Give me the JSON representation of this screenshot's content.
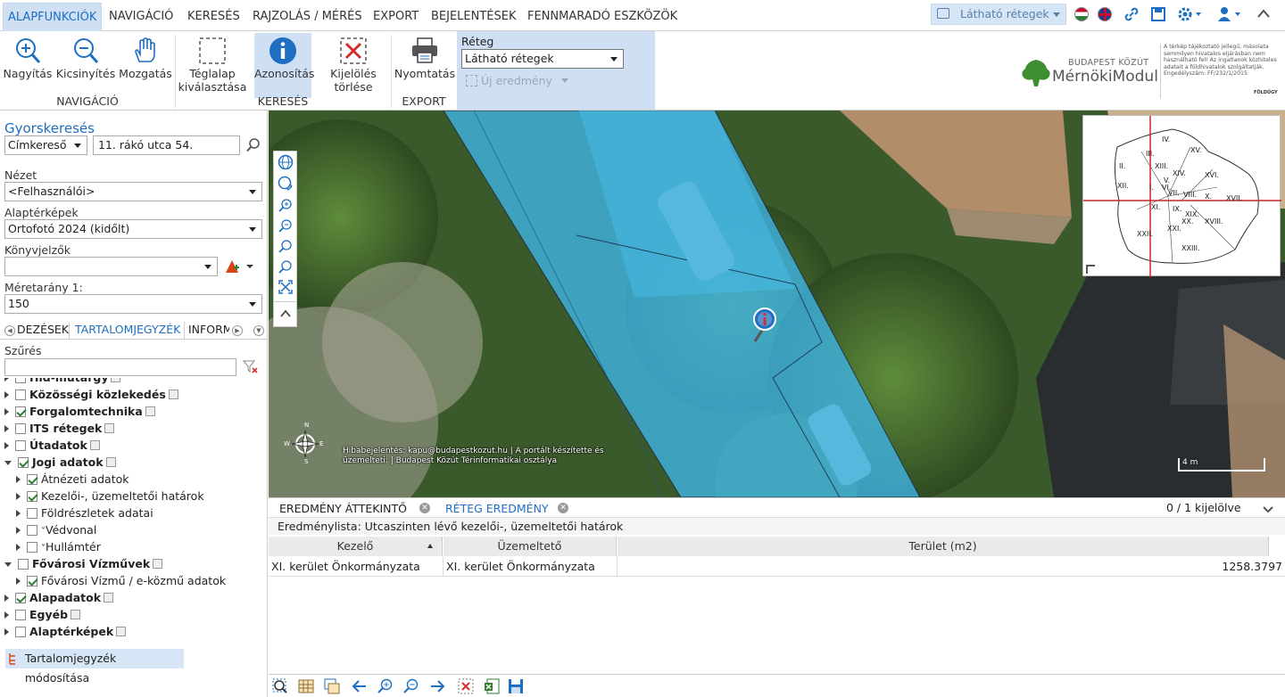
{
  "tabs": [
    "ALAPFUNKCIÓK",
    "NAVIGÁCIÓ",
    "KERESÉS",
    "RAJZOLÁS / MÉRÉS",
    "EXPORT",
    "BEJELENTÉSEK",
    "FENNMARADÓ ESZKÖZÖK"
  ],
  "topright": {
    "visible_layers": "Látható rétegek"
  },
  "ribbon": {
    "zoom_in": "Nagyítás",
    "zoom_out": "Kicsinyítés",
    "pan": "Mozgatás",
    "rect_select": "Téglalap kiválasztása",
    "identify": "Azonosítás",
    "clear_selection": "Kijelölés törlése",
    "print": "Nyomtatás",
    "group_nav": "NAVIGÁCIÓ",
    "group_search": "KERESÉS",
    "group_export": "EXPORT",
    "layer_label": "Réteg",
    "layer_value": "Látható rétegek",
    "new_result": "Új eredmény"
  },
  "logo": {
    "line1": "BUDAPEST KÖZÚT",
    "line2": "MérnökiModul",
    "disclaimer": "A térkép tájékoztató jellegű, másolata semmilyen hivatalos eljárásban nem használható fel! Az ingatlanok közhiteles adatait a földhivatalok szolgáltatják. Engedélyszám: FF/232/1/2015",
    "badge": "FÖLDÜGY"
  },
  "left": {
    "quicksearch_title": "Gyorskeresés",
    "search_type": "Címkereső",
    "search_value": "11. rákó utca 54.",
    "view_label": "Nézet",
    "view_value": "<Felhasználói>",
    "basemap_label": "Alaptérképek",
    "basemap_value": "Ortofotó 2024 (kidőlt)",
    "bookmarks_label": "Könyvjelzők",
    "scale_label": "Méretarány 1:",
    "scale_value": "150",
    "subtabs": [
      "DEZÉSEK",
      "TARTALOMJEGYZÉK",
      "INFORM"
    ],
    "filter_label": "Szűrés",
    "toc_edit": "Tartalomjegyzék módosítása",
    "tree": [
      {
        "label": "Híd-műtárgy",
        "bold": true,
        "checked": false,
        "level": 0,
        "open": false,
        "edit": true
      },
      {
        "label": "Közösségi közlekedés",
        "bold": true,
        "checked": false,
        "level": 0,
        "open": false,
        "edit": true
      },
      {
        "label": "Forgalomtechnika",
        "bold": true,
        "checked": true,
        "level": 0,
        "open": false,
        "edit": true
      },
      {
        "label": "ITS rétegek",
        "bold": true,
        "checked": false,
        "level": 0,
        "open": false,
        "edit": true
      },
      {
        "label": "Útadatok",
        "bold": true,
        "checked": false,
        "level": 0,
        "open": false,
        "edit": true
      },
      {
        "label": "Jogi adatok",
        "bold": true,
        "checked": true,
        "level": 0,
        "open": true,
        "edit": true
      },
      {
        "label": "Átnézeti adatok",
        "bold": false,
        "checked": true,
        "level": 1,
        "open": false,
        "edit": false
      },
      {
        "label": "Kezelői-, üzemeltetői határok",
        "bold": false,
        "checked": true,
        "level": 1,
        "open": false,
        "edit": false
      },
      {
        "label": "Földrészletek adatai",
        "bold": false,
        "checked": false,
        "level": 1,
        "open": false,
        "edit": false
      },
      {
        "label": "Védvonal",
        "bold": false,
        "checked": false,
        "level": 1,
        "open": false,
        "edit": false,
        "chev": true
      },
      {
        "label": "Hullámtér",
        "bold": false,
        "checked": false,
        "level": 1,
        "open": false,
        "edit": false,
        "chev": true
      },
      {
        "label": "Fővárosi Vízművek",
        "bold": true,
        "checked": false,
        "level": 0,
        "open": true,
        "edit": true
      },
      {
        "label": "Fővárosi Vízmű / e-közmű adatok",
        "bold": false,
        "checked": true,
        "level": 1,
        "open": false,
        "edit": false
      },
      {
        "label": "Alapadatok",
        "bold": true,
        "checked": true,
        "level": 0,
        "open": false,
        "edit": true
      },
      {
        "label": "Egyéb",
        "bold": true,
        "checked": false,
        "level": 0,
        "open": false,
        "edit": true
      },
      {
        "label": "Alaptérképek",
        "bold": true,
        "checked": false,
        "level": 0,
        "open": false,
        "edit": true
      }
    ]
  },
  "map": {
    "attribution_line1": "Hibabejelentés: kapu@budapestkozut.hu | A portált készítette és",
    "attribution_line2": "üzemelteti: | Budapest Közút Térinformatikai osztálya",
    "scale_text": "4 m",
    "compass": {
      "n": "N",
      "s": "S",
      "w": "W",
      "e": "E"
    },
    "districts": [
      "IV.",
      "XV.",
      "III.",
      "II.",
      "XIII.",
      "XIV.",
      "XVI.",
      "XII.",
      "I.",
      "VI.",
      "VII.",
      "V.",
      "VIII.",
      "X.",
      "XVII.",
      "XI.",
      "IX.",
      "XIX.",
      "XX.",
      "XXII.",
      "XXI.",
      "XVIII.",
      "XXIII."
    ]
  },
  "results": {
    "tab_overview": "EREDMÉNY ÁTTEKINTŐ",
    "tab_layer": "RÉTEG EREDMÉNY",
    "selected_count": "0 / 1 kijelölve",
    "list_title": "Eredménylista: Utcaszinten lévő kezelői-, üzemeltetői határok",
    "columns": [
      "Kezelő",
      "Üzemeltető",
      "Terület (m2)"
    ],
    "rows": [
      [
        "XI. kerület Önkormányzata",
        "XI. kerület Önkormányzata",
        "1258.3797"
      ]
    ]
  },
  "colors": {
    "accent": "#1e6fc2",
    "ribbon_active": "#cfe0f4",
    "highlight": "#3fb5e8"
  }
}
